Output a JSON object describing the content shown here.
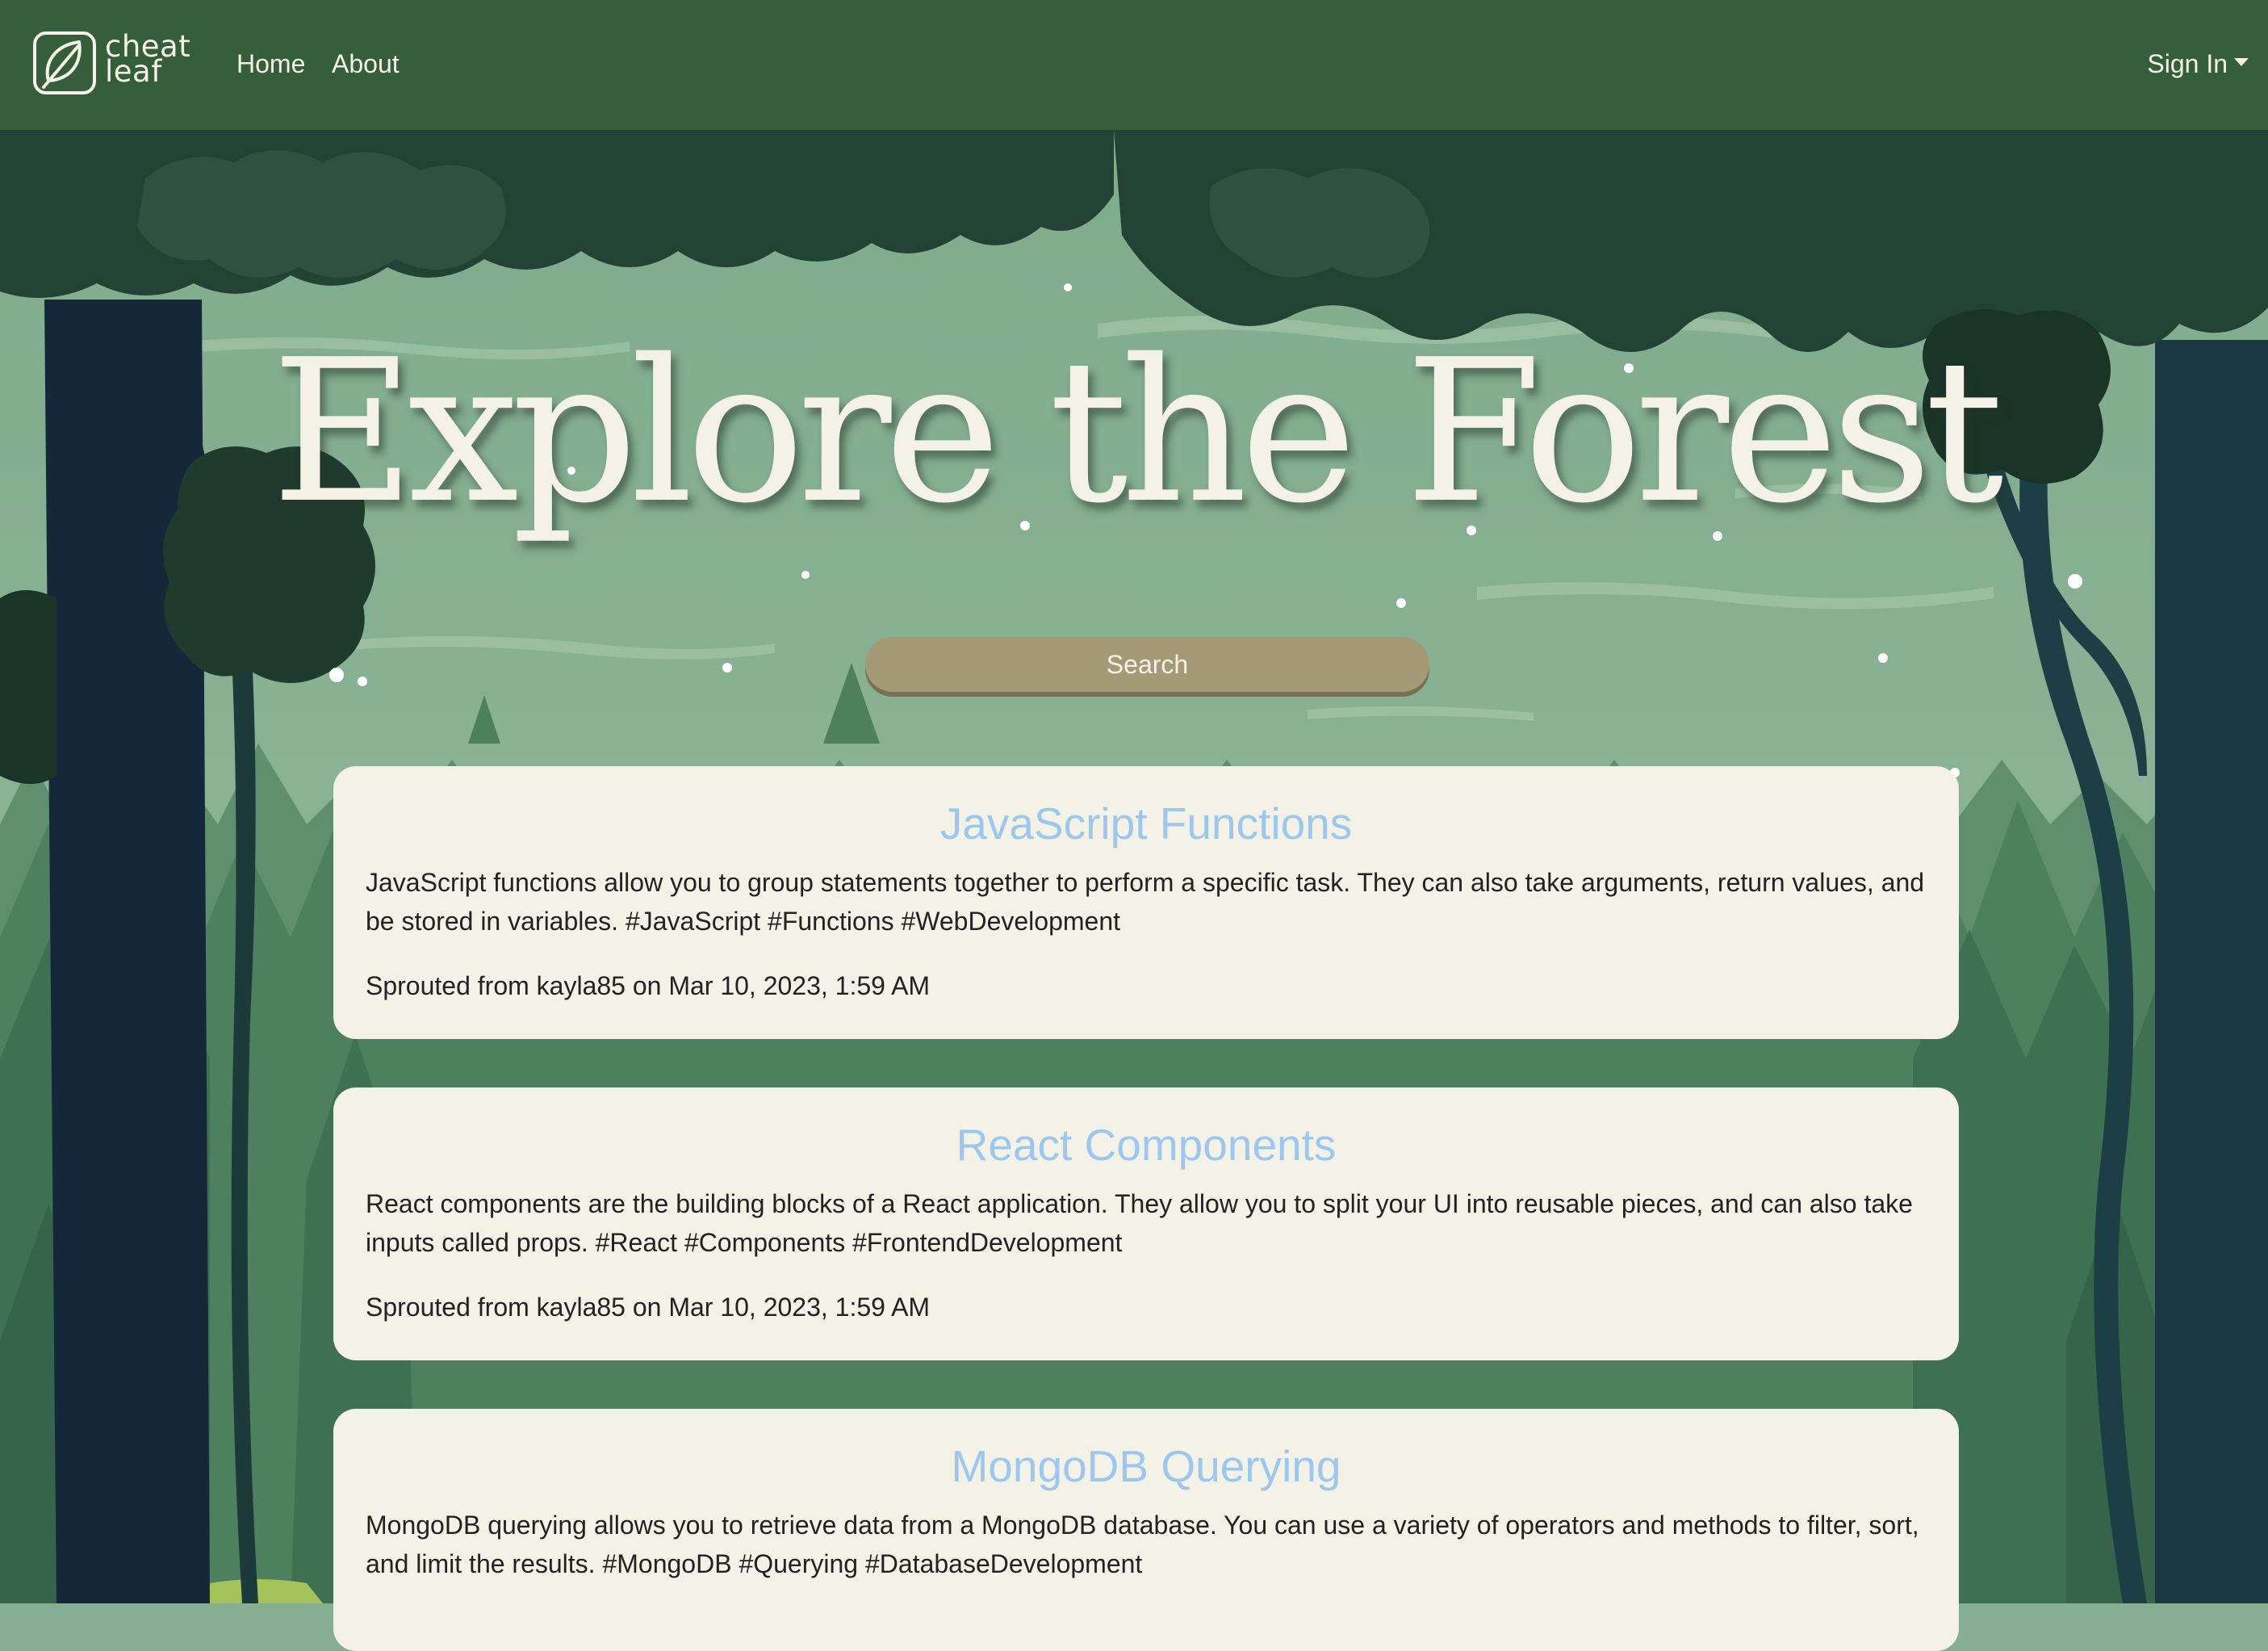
{
  "navbar": {
    "brand_line1": "cheat",
    "brand_line2": "leaf",
    "links": [
      {
        "label": "Home"
      },
      {
        "label": "About"
      }
    ],
    "signin_label": "Sign In"
  },
  "hero": {
    "title": "Explore the Forest",
    "search_label": "Search"
  },
  "posts": [
    {
      "title": "JavaScript Functions",
      "body": "JavaScript functions allow you to group statements together to perform a specific task. They can also take arguments, return values, and be stored in variables. #JavaScript #Functions #WebDevelopment",
      "meta": "Sprouted from kayla85 on Mar 10, 2023, 1:59 AM"
    },
    {
      "title": "React Components",
      "body": "React components are the building blocks of a React application. They allow you to split your UI into reusable pieces, and can also take inputs called props. #React #Components #FrontendDevelopment",
      "meta": "Sprouted from kayla85 on Mar 10, 2023, 1:59 AM"
    },
    {
      "title": "MongoDB Querying",
      "body": "MongoDB querying allows you to retrieve data from a MongoDB database. You can use a variety of operators and methods to filter, sort, and limit the results. #MongoDB #Querying #DatabaseDevelopment"
    }
  ],
  "colors": {
    "navbar": "#355e3b",
    "sky": "#86ae92",
    "card": "#f4f1e6",
    "card_title": "#9cc7ee",
    "search_button": "#a59a76"
  }
}
